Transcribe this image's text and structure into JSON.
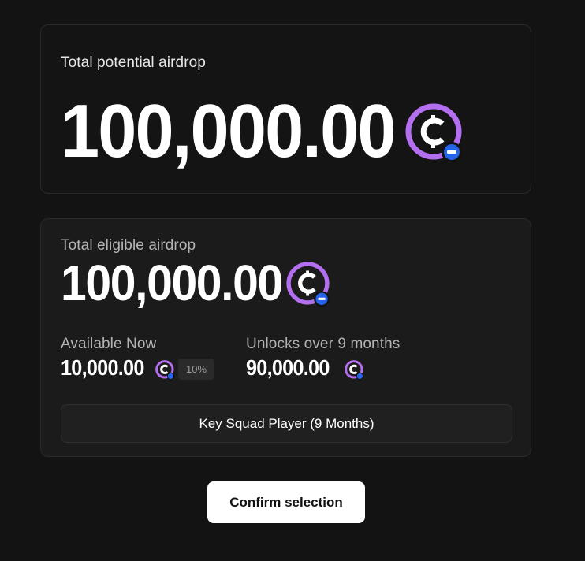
{
  "potential": {
    "label": "Total potential airdrop",
    "amount": "100,000.00",
    "token_icon": "coin-c-icon"
  },
  "eligible": {
    "label": "Total eligible airdrop",
    "amount": "100,000.00",
    "token_icon": "coin-c-icon",
    "available_now": {
      "label": "Available Now",
      "amount": "10,000.00",
      "percent_badge": "10%"
    },
    "unlocks": {
      "label": "Unlocks over 9 months",
      "amount": "90,000.00"
    },
    "plan_button_label": "Key Squad Player (9 Months)"
  },
  "confirm_button_label": "Confirm selection",
  "colors": {
    "background": "#131313",
    "coin_ring": "#b46ef0",
    "coin_badge": "#2563eb",
    "confirm_bg": "#ffffff"
  }
}
